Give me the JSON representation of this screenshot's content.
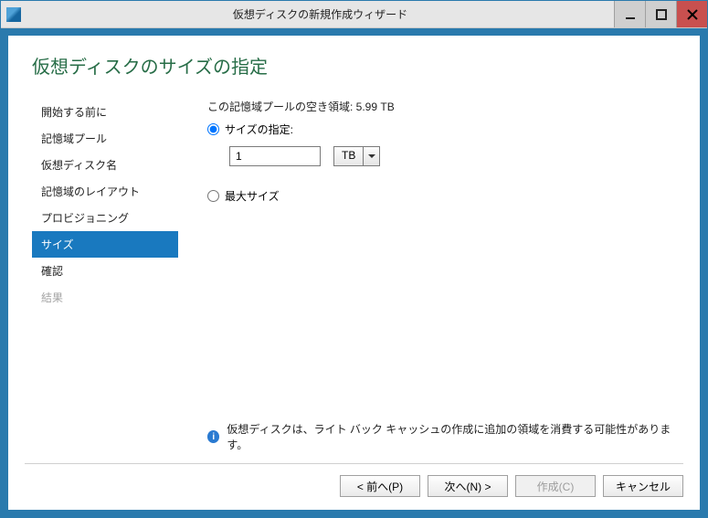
{
  "titlebar": {
    "title": "仮想ディスクの新規作成ウィザード"
  },
  "page_title": "仮想ディスクのサイズの指定",
  "nav": {
    "items": [
      {
        "label": "開始する前に"
      },
      {
        "label": "記憶域プール"
      },
      {
        "label": "仮想ディスク名"
      },
      {
        "label": "記憶域のレイアウト"
      },
      {
        "label": "プロビジョニング"
      },
      {
        "label": "サイズ"
      },
      {
        "label": "確認"
      },
      {
        "label": "結果"
      }
    ]
  },
  "main": {
    "free_space_label": "この記憶域プールの空き領域: 5.99 TB",
    "specify_size_label": "サイズの指定:",
    "size_value": "1",
    "unit_value": "TB",
    "max_size_label": "最大サイズ",
    "info_text": "仮想ディスクは、ライト バック キャッシュの作成に追加の領域を消費する可能性があります。"
  },
  "footer": {
    "prev": "< 前へ(P)",
    "next": "次へ(N) >",
    "create": "作成(C)",
    "cancel": "キャンセル"
  }
}
